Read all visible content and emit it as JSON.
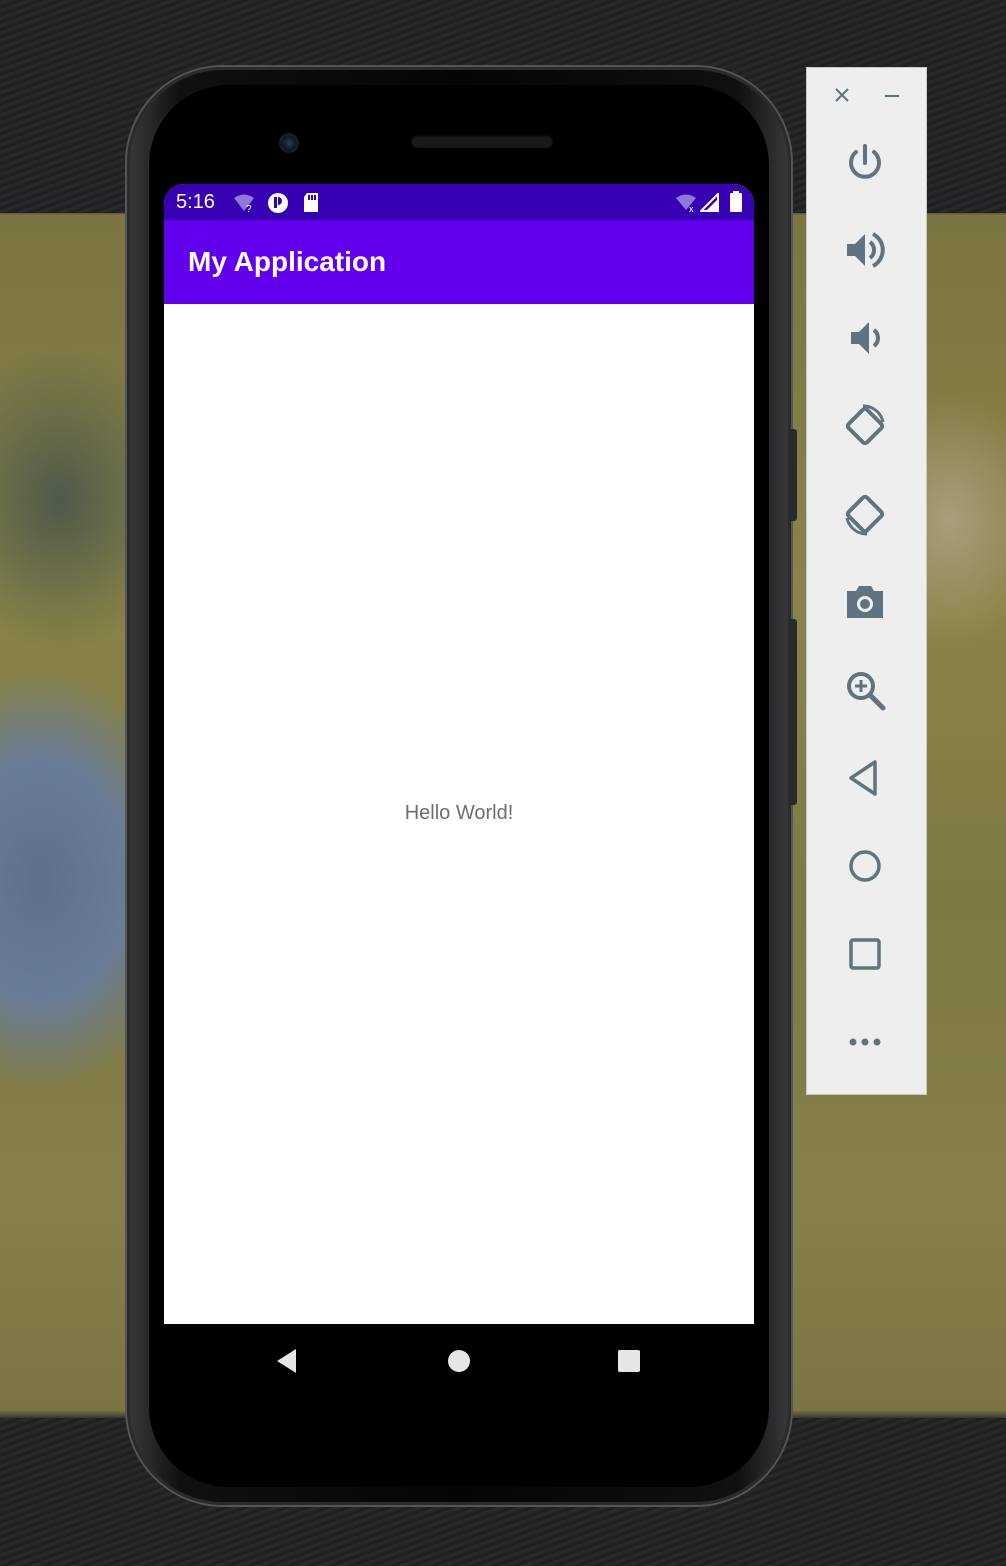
{
  "status_bar": {
    "time": "5:16",
    "icons": [
      "wifi-unknown-icon",
      "app-notification-icon",
      "sd-card-icon",
      "wifi-no-internet-icon",
      "cell-signal-icon",
      "battery-icon"
    ]
  },
  "app_bar": {
    "title": "My Application"
  },
  "content": {
    "text": "Hello World!"
  },
  "nav_bar": {
    "buttons": [
      "back-icon",
      "home-icon",
      "recents-icon"
    ]
  },
  "emulator_toolbar": {
    "window_controls": [
      "close-icon",
      "minimize-icon"
    ],
    "buttons": [
      "power-icon",
      "volume-up-icon",
      "volume-down-icon",
      "rotate-left-icon",
      "rotate-right-icon",
      "camera-icon",
      "zoom-icon",
      "back-icon",
      "home-icon",
      "overview-icon",
      "more-icon"
    ]
  },
  "colors": {
    "status_bar": "#3700b3",
    "app_bar": "#6200ee",
    "emulator_icon": "#5f7380",
    "text_secondary": "#6e6e6e"
  }
}
